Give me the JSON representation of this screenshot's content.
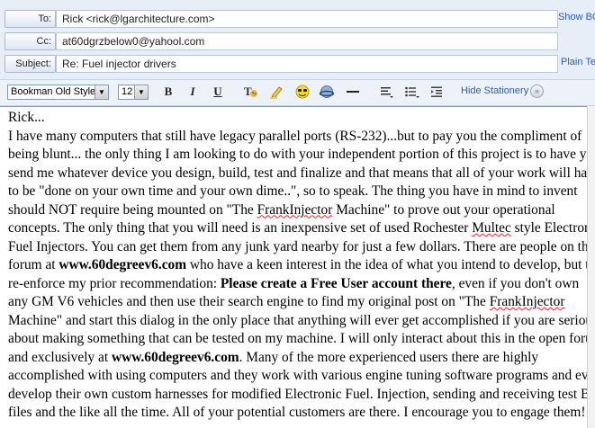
{
  "header": {
    "to_label": "To:",
    "to_value": "Rick <rick@lgarchitecture.com>",
    "show_bcc": "Show BCC",
    "cc_label": "Cc:",
    "cc_value": "at60dgrzbelow0@yahool.com",
    "subject_label": "Subject:",
    "subject_value": "Re: Fuel injector drivers",
    "plain_text": "Plain Text"
  },
  "toolbar": {
    "font_family": "Bookman Old Style",
    "font_size": "12",
    "bold": "B",
    "italic": "I",
    "underline": "U",
    "hide_stationery": "Hide Stationery"
  },
  "message": {
    "lines": [
      [
        {
          "t": "Rick..."
        }
      ],
      [
        {
          "t": "I have many computers that still have legacy parallel ports (RS-232)...but to pay you the compliment of"
        }
      ],
      [
        {
          "t": "being blunt... the only thing I am looking to do with your independent portion of this project is to have you"
        }
      ],
      [
        {
          "t": "send me whatever device you design, build, test and finalize and that means that all of your work will have"
        }
      ],
      [
        {
          "t": "to be \"done on your own time and your own dime..\", so to speak. The thing you have in mind to invent"
        }
      ],
      [
        {
          "t": "should NOT require being mounted on \"The "
        },
        {
          "t": "FrankInjector",
          "s": 1
        },
        {
          "t": " Machine\" to prove out your operational"
        }
      ],
      [
        {
          "t": "concepts. The only thing that you will need is an inexpensive set of used Rochester "
        },
        {
          "t": "Multec",
          "s": 1
        },
        {
          "t": " style Electronic"
        }
      ],
      [
        {
          "t": "Fuel Injectors. You can get them from any junk yard nearby for just a few dollars. There are people on the"
        }
      ],
      [
        {
          "t": "forum at "
        },
        {
          "t": "www.60degreev6.com",
          "b": 1
        },
        {
          "t": " who have a keen interest in the idea of what you intend to develop, but to"
        }
      ],
      [
        {
          "t": "re-enforce my prior recommendation: "
        },
        {
          "t": "Please create a Free User account there",
          "b": 1
        },
        {
          "t": ", even if you don't own"
        }
      ],
      [
        {
          "t": "any GM V6 vehicles and then use their search engine to find my original post on \"The "
        },
        {
          "t": "FrankInjector",
          "s": 1
        }
      ],
      [
        {
          "t": "Machine\" and start this dialog in the only place that anything will ever get accomplished if you are serious"
        }
      ],
      [
        {
          "t": "about making something that can be tested on my machine. I will only interact about this in the open forum"
        }
      ],
      [
        {
          "t": "and exclusively at "
        },
        {
          "t": "www.60degreev6.com",
          "b": 1
        },
        {
          "t": ". Many of the more experienced users there are highly"
        }
      ],
      [
        {
          "t": "accomplished with using computers and they work with various engine tuning software programs and even"
        }
      ],
      [
        {
          "t": "develop their own custom harnesses for modified Electronic Fuel. Injection, sending and receiving test BIN"
        }
      ],
      [
        {
          "t": "files and the like all the time. All of your potential customers are there. I encourage you to engage them!"
        }
      ]
    ]
  },
  "colors": {
    "panel_bg": "#e8eef8",
    "link": "#2a5db0",
    "spellcheck": "#ff2020"
  }
}
